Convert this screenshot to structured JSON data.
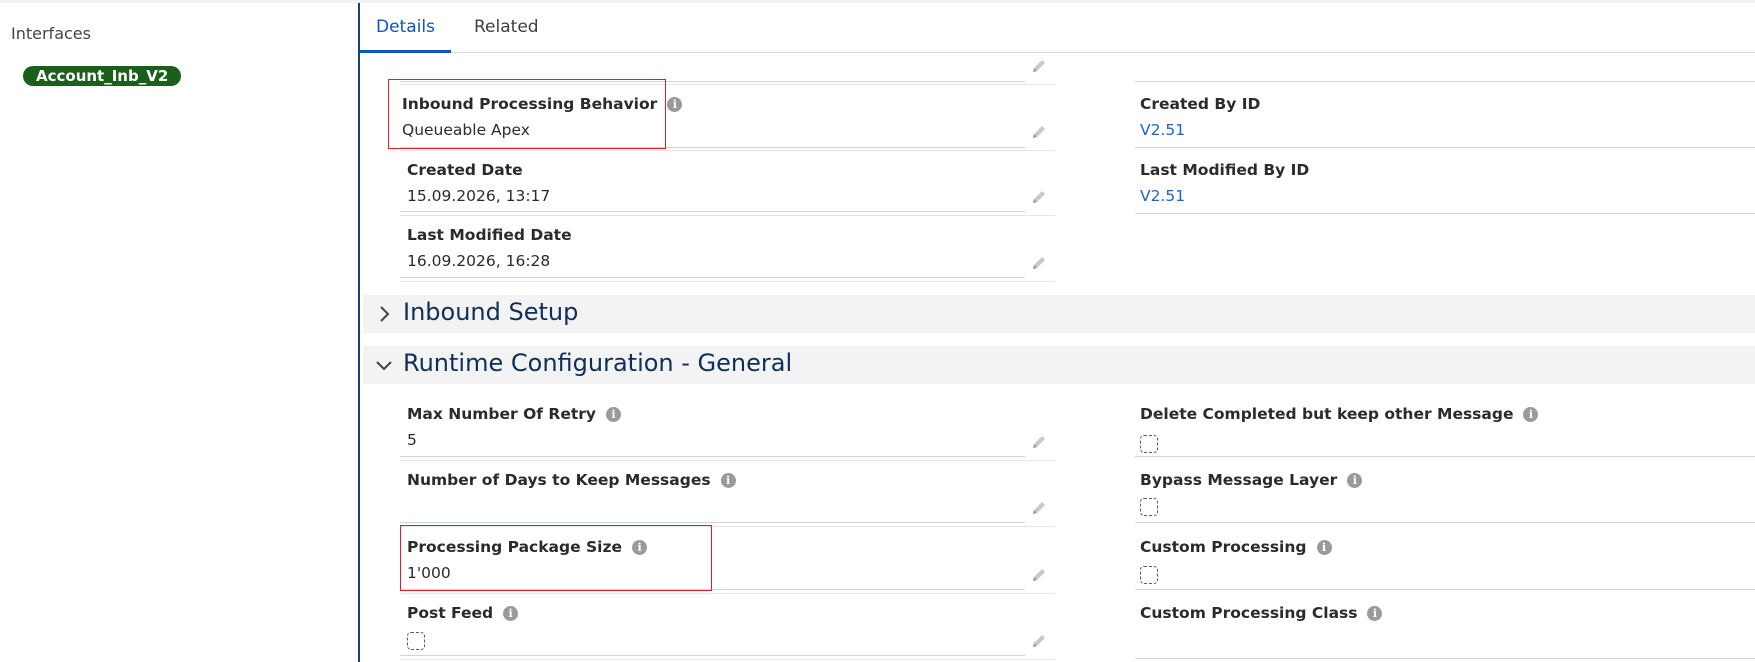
{
  "sidebar": {
    "title": "Interfaces",
    "record_name": "Account_Inb_V2"
  },
  "tabs": [
    {
      "label": "Details",
      "active": true
    },
    {
      "label": "Related",
      "active": false
    }
  ],
  "details": {
    "inbound_processing_behavior": {
      "label": "Inbound Processing Behavior",
      "value": "Queueable Apex"
    },
    "created_by_id": {
      "label": "Created By ID",
      "value": "V2.51"
    },
    "created_date": {
      "label": "Created Date",
      "value": "15.09.2026, 13:17"
    },
    "last_modified_by_id": {
      "label": "Last Modified By ID",
      "value": "V2.51"
    },
    "last_modified_date": {
      "label": "Last Modified Date",
      "value": "16.09.2026, 16:28"
    }
  },
  "sections": {
    "inbound_setup": {
      "title": "Inbound Setup",
      "expanded": false
    },
    "runtime_general": {
      "title": "Runtime Configuration - General",
      "expanded": true
    }
  },
  "runtime": {
    "max_retry": {
      "label": "Max Number Of Retry",
      "value": "5"
    },
    "delete_completed": {
      "label": "Delete Completed but keep other Message",
      "checked": false
    },
    "days_keep": {
      "label": "Number of Days to Keep Messages",
      "value": ""
    },
    "bypass_layer": {
      "label": "Bypass Message Layer",
      "checked": false
    },
    "package_size": {
      "label": "Processing Package Size",
      "value": "1'000"
    },
    "custom_processing": {
      "label": "Custom Processing",
      "checked": false
    },
    "post_feed": {
      "label": "Post Feed",
      "checked": false
    },
    "custom_processing_class": {
      "label": "Custom Processing Class",
      "value": ""
    }
  },
  "colors": {
    "accent": "#0b55c4",
    "highlight": "#e01f2a",
    "badge": "#1a5f1a",
    "link": "#1b63c6"
  },
  "icons": {
    "info": "info-icon",
    "edit": "pencil-icon",
    "collapsed": "chevron-right-icon",
    "expanded": "chevron-down-icon"
  }
}
